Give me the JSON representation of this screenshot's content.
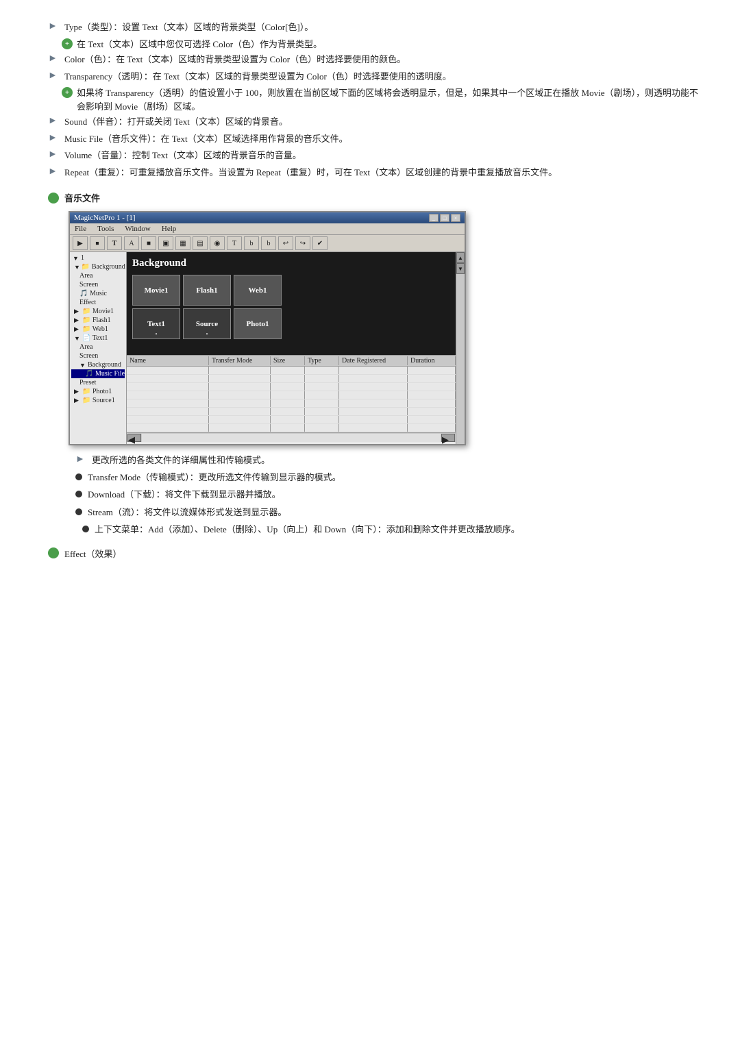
{
  "bullets": [
    {
      "id": "type",
      "text": "Type（类型）：设置 Text（文本）区域的背景类型（Color[色]）。",
      "sub": "在 Text（文本）区域中您仅可选择 Color（色）作为背景类型。"
    },
    {
      "id": "color",
      "text": "Color（色）：在 Text（文本）区域的背景类型设置为 Color（色）时选择要使用的颜色。"
    },
    {
      "id": "transparency",
      "text": "Transparency（透明）：在 Text（文本）区域的背景类型设置为 Color（色）时选择要使用的透明度。",
      "sub": "如果将 Transparency（透明）的值设置小于 100，则放置在当前区域下面的区域将会透明显示，但是，如果其中一个区域正在播放 Movie（剧场），则透明功能不会影响到 Movie（剧场）区域。"
    },
    {
      "id": "sound",
      "text": "Sound（伴音）：打开或关闭 Text（文本）区域的背景音。"
    },
    {
      "id": "musicfile",
      "text": "Music File（音乐文件）：在 Text（文本）区域选择用作背景的音乐文件。"
    },
    {
      "id": "volume",
      "text": "Volume（音量）：控制 Text（文本）区域的背景音乐的音量。"
    },
    {
      "id": "repeat",
      "text": "Repeat（重复）：可重复播放音乐文件。当设置为 Repeat（重复）时，可在 Text（文本）区域创建的背景中重复播放音乐文件。"
    }
  ],
  "music_file_label": "音乐文件",
  "window": {
    "title": "MagicNetPro 1 - [1]",
    "menus": [
      "File",
      "Tools",
      "Window",
      "Help"
    ],
    "toolbar_icons": [
      "▶",
      "⏹",
      "T",
      "A",
      "■",
      "▣",
      "▦",
      "▤",
      "◉",
      "T",
      "b",
      "b",
      "↩",
      "↪",
      "✔"
    ],
    "tree": [
      {
        "label": "1",
        "indent": 0
      },
      {
        "label": "Background",
        "indent": 1,
        "icon": "📁"
      },
      {
        "label": "Area",
        "indent": 2
      },
      {
        "label": "Screen",
        "indent": 2
      },
      {
        "label": "Music",
        "indent": 2
      },
      {
        "label": "Effect",
        "indent": 2
      },
      {
        "label": "Movie1",
        "indent": 1,
        "icon": "📁"
      },
      {
        "label": "Flash1",
        "indent": 1,
        "icon": "📁"
      },
      {
        "label": "Web1",
        "indent": 1,
        "icon": "📁"
      },
      {
        "label": "Text1",
        "indent": 1,
        "icon": "📁"
      },
      {
        "label": "Area",
        "indent": 2
      },
      {
        "label": "Screen",
        "indent": 2
      },
      {
        "label": "Background",
        "indent": 2
      },
      {
        "label": "Music File",
        "indent": 3,
        "selected": true
      },
      {
        "label": "Preset",
        "indent": 2
      },
      {
        "label": "Photo1",
        "indent": 1,
        "icon": "📁"
      },
      {
        "label": "Source1",
        "indent": 1,
        "icon": "📁"
      }
    ],
    "background_title": "Background",
    "grid": [
      [
        {
          "label": "Movie1",
          "type": "dark"
        },
        {
          "label": "Flash1",
          "type": "dark"
        },
        {
          "label": "Web1",
          "type": "dark"
        }
      ],
      [
        {
          "label": "Text1",
          "type": "text"
        },
        {
          "label": "Source",
          "type": "text"
        },
        {
          "label": "Photo1",
          "type": "dark"
        }
      ]
    ],
    "file_list_headers": [
      "Name",
      "Transfer Mode",
      "Size",
      "Type",
      "Date Registered",
      "Duration"
    ],
    "file_rows": [
      [],
      [],
      [],
      [],
      [],
      [],
      [],
      [],
      []
    ]
  },
  "desc_label": "更改所选的各类文件的详细属性和传输模式。",
  "desc_items": [
    {
      "id": "transfer-mode",
      "text": "Transfer Mode（传输模式）：更改所选文件传输到显示器的模式。"
    },
    {
      "id": "download",
      "text": "Download（下载）：将文件下载到显示器并播放。"
    },
    {
      "id": "stream",
      "text": "Stream（流）：将文件以流媒体形式发送到显示器。"
    },
    {
      "id": "add-delete",
      "text": "上下文菜单：Add（添加）、Delete（删除）、Up（向上）和 Down（向下）：添加和删除文件并更改播放顺序。",
      "is_sub": true
    }
  ],
  "effect_label": "Effect（效果）"
}
